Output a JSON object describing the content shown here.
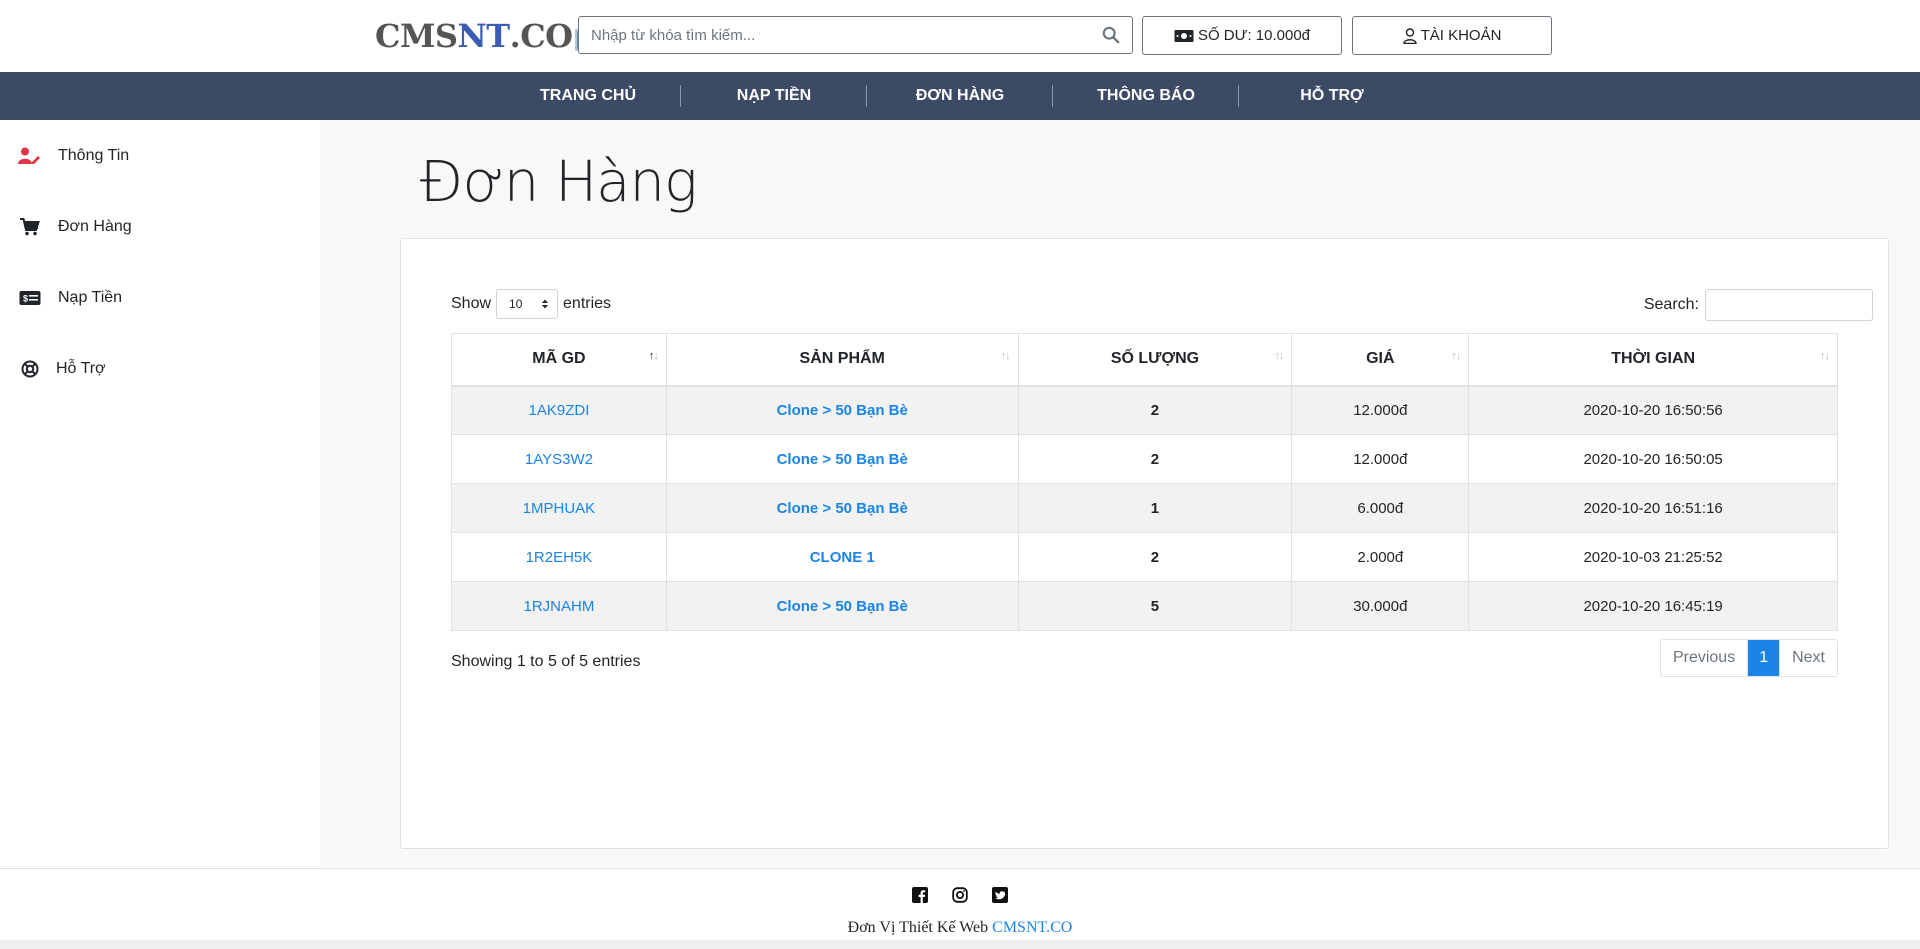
{
  "header": {
    "logo": {
      "part1": "CMS",
      "part2": "NT",
      "part3": ".CO"
    },
    "search_placeholder": "Nhập từ khóa tìm kiếm...",
    "balance_label": "SỐ DƯ: 10.000đ",
    "account_label": "TÀI KHOẢN"
  },
  "nav": {
    "items": [
      "TRANG CHỦ",
      "NẠP TIỀN",
      "ĐƠN HÀNG",
      "THÔNG BÁO",
      "HỖ TRỢ"
    ]
  },
  "sidebar": {
    "items": [
      {
        "label": "Thông Tin",
        "icon": "user-edit-icon",
        "color": "#dc3545"
      },
      {
        "label": "Đơn Hàng",
        "icon": "cart-icon",
        "color": "#212529"
      },
      {
        "label": "Nạp Tiền",
        "icon": "money-card-icon",
        "color": "#212529"
      },
      {
        "label": "Hỗ Trợ",
        "icon": "lifebuoy-icon",
        "color": "#212529"
      }
    ]
  },
  "page": {
    "title": "Đơn Hàng"
  },
  "table_controls": {
    "show_label": "Show",
    "entries_label": "entries",
    "page_size": "10",
    "search_label": "Search:",
    "search_value": ""
  },
  "table": {
    "columns": [
      "MÃ GD",
      "SẢN PHẨM",
      "SỐ LƯỢNG",
      "GIÁ",
      "THỜI GIAN"
    ],
    "rows": [
      {
        "code": "1AK9ZDI",
        "product": "Clone > 50 Bạn Bè",
        "qty": "2",
        "price": "12.000đ",
        "time": "2020-10-20 16:50:56"
      },
      {
        "code": "1AYS3W2",
        "product": "Clone > 50 Bạn Bè",
        "qty": "2",
        "price": "12.000đ",
        "time": "2020-10-20 16:50:05"
      },
      {
        "code": "1MPHUAK",
        "product": "Clone > 50 Bạn Bè",
        "qty": "1",
        "price": "6.000đ",
        "time": "2020-10-20 16:51:16"
      },
      {
        "code": "1R2EH5K",
        "product": "CLONE 1",
        "qty": "2",
        "price": "2.000đ",
        "time": "2020-10-03 21:25:52"
      },
      {
        "code": "1RJNAHM",
        "product": "Clone > 50 Bạn Bè",
        "qty": "5",
        "price": "30.000đ",
        "time": "2020-10-20 16:45:19"
      }
    ]
  },
  "pagination": {
    "info": "Showing 1 to 5 of 5 entries",
    "previous": "Previous",
    "current": "1",
    "next": "Next"
  },
  "footer": {
    "social_icons": [
      "facebook-icon",
      "instagram-icon",
      "twitter-icon"
    ],
    "credit_text": "Đơn Vị Thiết Kế Web",
    "credit_link": "CMSNT.CO"
  },
  "colors": {
    "nav_bg": "#3c4a66",
    "link": "#1b84e7",
    "accent_red": "#dc3545"
  }
}
